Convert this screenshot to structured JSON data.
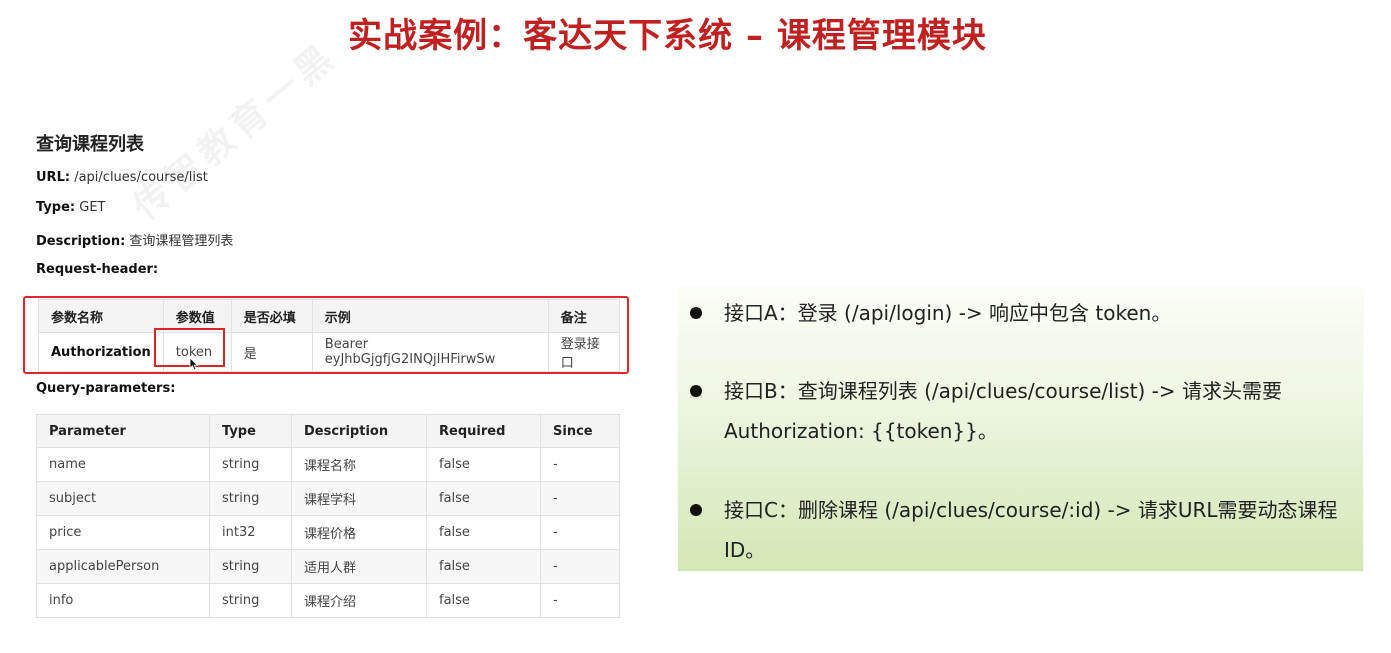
{
  "slide": {
    "title": "实战案例：客达天下系统  –  课程管理模块"
  },
  "watermark": "传智教育一黑",
  "doc": {
    "title": "查询课程列表",
    "url_label": "URL:",
    "url_value": "/api/clues/course/list",
    "type_label": "Type:",
    "type_value": "GET",
    "desc_label": "Description:",
    "desc_value": "查询课程管理列表",
    "request_header_label": "Request-header:",
    "query_params_label": "Query-parameters:"
  },
  "header_table": {
    "columns": [
      "参数名称",
      "参数值",
      "是否必填",
      "示例",
      "备注"
    ],
    "row": [
      "Authorization",
      "token",
      "是",
      "Bearer eyJhbGjgfjG2INQjIHFirwSw",
      "登录接口"
    ]
  },
  "query_table": {
    "columns": [
      "Parameter",
      "Type",
      "Description",
      "Required",
      "Since"
    ],
    "rows": [
      [
        "name",
        "string",
        "课程名称",
        "false",
        "-"
      ],
      [
        "subject",
        "string",
        "课程学科",
        "false",
        "-"
      ],
      [
        "price",
        "int32",
        "课程价格",
        "false",
        "-"
      ],
      [
        "applicablePerson",
        "string",
        "适用人群",
        "false",
        "-"
      ],
      [
        "info",
        "string",
        "课程介绍",
        "false",
        "-"
      ]
    ]
  },
  "panel": {
    "bullets": [
      "接口A：登录 (/api/login) -> 响应中包含 token。",
      "接口B：查询课程列表 (/api/clues/course/list) -> 请求头需要 Authorization: {{token}}。",
      "接口C：删除课程 (/api/clues/course/:id) -> 请求URL需要动态课程ID。"
    ]
  },
  "colors": {
    "title_red": "#c0201f",
    "highlight_red": "#e0272a",
    "panel_green": "#d3e7b5"
  }
}
